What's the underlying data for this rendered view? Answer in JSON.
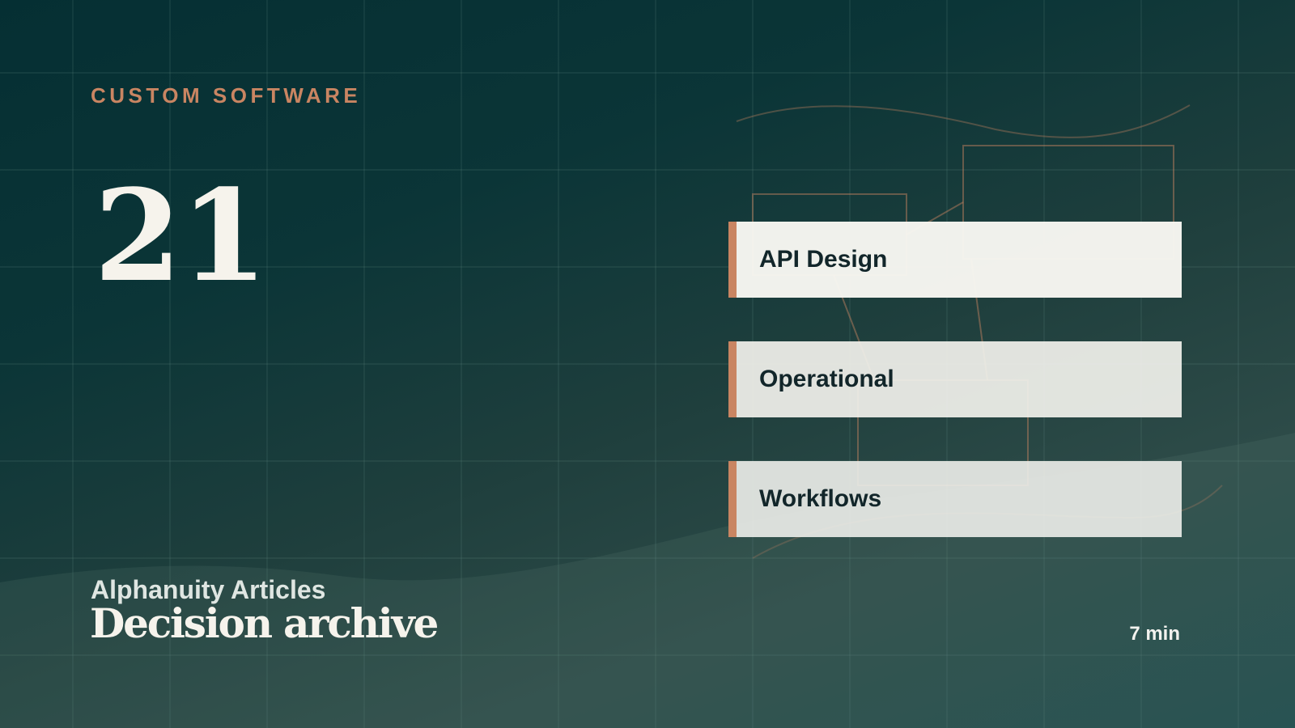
{
  "header": {
    "eyebrow": "CUSTOM SOFTWARE"
  },
  "issue": {
    "number": "21"
  },
  "topics": [
    {
      "label": "API Design"
    },
    {
      "label": "Operational"
    },
    {
      "label": "Workflows"
    }
  ],
  "footer": {
    "publisher": "Alphanuity Articles",
    "title": "Decision archive",
    "read_time": "7 min"
  },
  "colors": {
    "background_dark": "#052f33",
    "accent": "#c98562",
    "text_light": "#f6f3ec",
    "text_dark": "#12262a",
    "grid_line": "#4f7a73"
  }
}
